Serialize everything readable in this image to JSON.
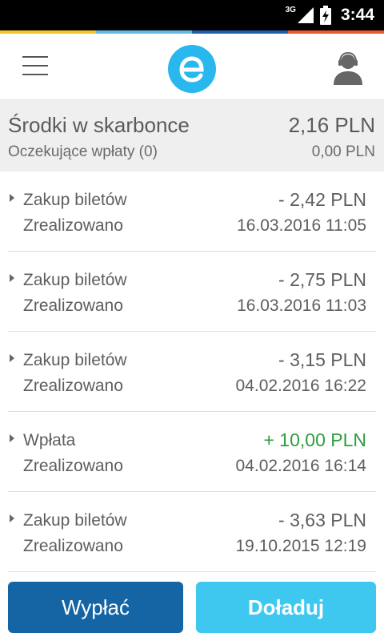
{
  "colors": {
    "stripe": [
      "#f4c52a",
      "#5fb9e2",
      "#1c5ea8",
      "#e8592b"
    ],
    "logo": "#29b8ee",
    "positive": "#2e9d3f",
    "withdraw_button": "#1564a4",
    "topup_button": "#3ec8f0"
  },
  "status_bar": {
    "network": "3G",
    "time": "3:44"
  },
  "balance": {
    "label": "Środki w skarbonce",
    "value": "2,16 PLN",
    "pending_label": "Oczekujące wpłaty (0)",
    "pending_value": "0,00 PLN"
  },
  "transactions": [
    {
      "title": "Zakup biletów",
      "amount": "- 2,42 PLN",
      "status": "Zrealizowano",
      "date": "16.03.2016 11:05"
    },
    {
      "title": "Zakup biletów",
      "amount": "- 2,75 PLN",
      "status": "Zrealizowano",
      "date": "16.03.2016 11:03"
    },
    {
      "title": "Zakup biletów",
      "amount": "- 3,15 PLN",
      "status": "Zrealizowano",
      "date": "04.02.2016 16:22"
    },
    {
      "title": "Wpłata",
      "amount": "+ 10,00 PLN",
      "status": "Zrealizowano",
      "date": "04.02.2016 16:14"
    },
    {
      "title": "Zakup biletów",
      "amount": "- 3,63 PLN",
      "status": "Zrealizowano",
      "date": "19.10.2015 12:19"
    }
  ],
  "buttons": {
    "withdraw": "Wypłać",
    "topup": "Doładuj"
  }
}
